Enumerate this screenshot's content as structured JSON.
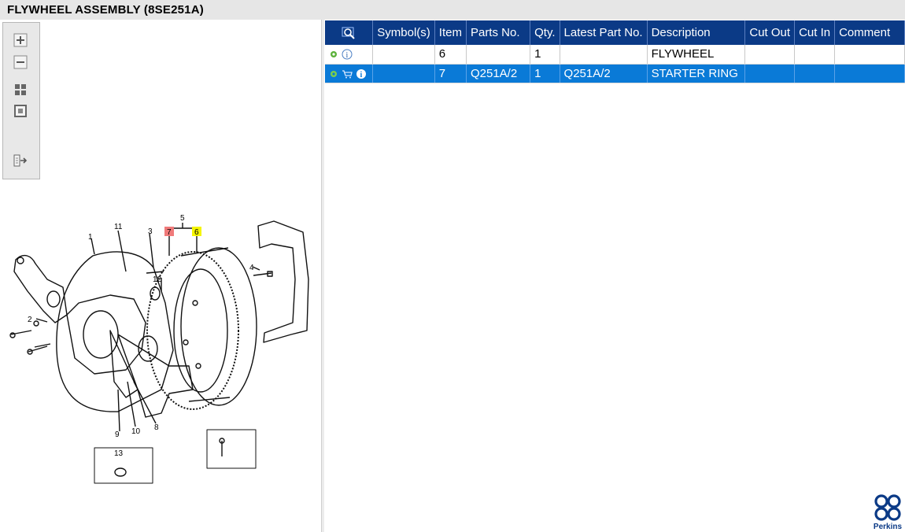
{
  "window": {
    "title": "FLYWHEEL ASSEMBLY (8SE251A)"
  },
  "toolbar": {
    "buttons": [
      {
        "name": "zoom-in-button",
        "icon": "zoom-in-icon"
      },
      {
        "name": "zoom-out-button",
        "icon": "zoom-out-icon"
      },
      {
        "name": "fit-page-button",
        "icon": "fit-icon"
      },
      {
        "name": "actual-size-button",
        "icon": "actual-size-icon"
      },
      {
        "name": "export-button",
        "icon": "export-icon"
      }
    ]
  },
  "drawing": {
    "callouts": [
      "1",
      "2",
      "3",
      "4",
      "5",
      "6",
      "7",
      "8",
      "9",
      "10",
      "11",
      "12",
      "13"
    ],
    "highlight_colors": {
      "selected": "#f07a7a",
      "related": "#f5f500"
    }
  },
  "table": {
    "headers": {
      "symbols": "Symbol(s)",
      "item": "Item",
      "parts_no": "Parts No.",
      "qty": "Qty.",
      "latest_part_no": "Latest Part No.",
      "description": "Description",
      "cut_out": "Cut Out",
      "cut_in": "Cut In",
      "comment": "Comment"
    },
    "rows": [
      {
        "item": "6",
        "parts_no": "",
        "qty": "1",
        "latest_part_no": "",
        "description": "FLYWHEEL",
        "cut_out": "",
        "cut_in": "",
        "comment": ""
      },
      {
        "item": "7",
        "parts_no": "Q251A/2",
        "qty": "1",
        "latest_part_no": "Q251A/2",
        "description": "STARTER RING",
        "cut_out": "",
        "cut_in": "",
        "comment": ""
      }
    ]
  },
  "brand": {
    "name": "Perkins",
    "color": "#0b3a86"
  },
  "colors": {
    "header_bg": "#0b3a86",
    "selected_row": "#0a7ad7"
  }
}
